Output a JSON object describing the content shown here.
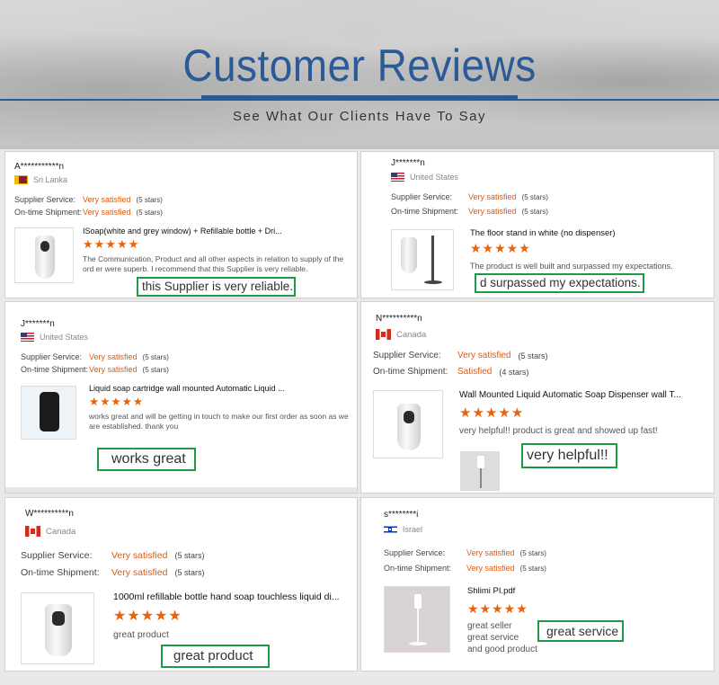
{
  "header": {
    "title": "Customer Reviews",
    "subtitle": "See What Our Clients Have To Say"
  },
  "labels": {
    "supplier": "Supplier Service:",
    "shipment": "On-time Shipment:"
  },
  "reviews": [
    {
      "name": "A***********n",
      "country": "Sri Lanka",
      "supplier_value": "Very satisfied",
      "supplier_stars": "(5 stars)",
      "shipment_value": "Very satisfied",
      "shipment_stars": "(5 stars)",
      "product": "ISoap(white and grey window) + Refillable bottle + Dri...",
      "stars": "★★★★★",
      "text": "The Communication, Product and all other aspects in relation to supply of the ord er were superb. I recommend that this Supplier is very reliable.",
      "callout": "this Supplier is very reliable."
    },
    {
      "name": "J*******n",
      "country": "United States",
      "supplier_value": "Very satisfied",
      "supplier_stars": "(5 stars)",
      "shipment_value": "Very satisfied",
      "shipment_stars": "(5 stars)",
      "product": "The floor stand in white (no dispenser)",
      "stars": "★★★★★",
      "text": "The product is well built and surpassed my expectations.",
      "callout": "d surpassed my expectations."
    },
    {
      "name": "J*******n",
      "country": "United States",
      "supplier_value": "Very satisfied",
      "supplier_stars": "(5 stars)",
      "shipment_value": "Very satisfied",
      "shipment_stars": "(5 stars)",
      "product": "Liquid soap cartridge wall mounted Automatic Liquid ...",
      "stars": "★★★★★",
      "text": "works great and will be getting in touch to make our first order as soon as we are established. thank you",
      "callout": "works great"
    },
    {
      "name": "N**********n",
      "country": "Canada",
      "supplier_value": "Very satisfied",
      "supplier_stars": "(5 stars)",
      "shipment_value": "Satisfied",
      "shipment_stars": "(4 stars)",
      "product": "Wall Mounted Liquid Automatic Soap Dispenser wall T...",
      "stars": "★★★★★",
      "text": "very helpful!! product is great and showed up fast!",
      "callout": "very helpful!!"
    },
    {
      "name": "W**********n",
      "country": "Canada",
      "supplier_value": "Very satisfied",
      "supplier_stars": "(5 stars)",
      "shipment_value": "Very satisfied",
      "shipment_stars": "(5 stars)",
      "product": "1000ml refillable bottle hand soap touchless liquid di...",
      "stars": "★★★★★",
      "text": "great product",
      "callout": "great product"
    },
    {
      "name": "s********i",
      "country": "Israel",
      "supplier_value": "Very satisfied",
      "supplier_stars": "(5 stars)",
      "shipment_value": "Very satisfied",
      "shipment_stars": "(5 stars)",
      "product": "Shlimi PI.pdf",
      "stars": "★★★★★",
      "text_lines": [
        "great seller",
        "great service",
        "and good product"
      ],
      "callout": "great service"
    }
  ]
}
